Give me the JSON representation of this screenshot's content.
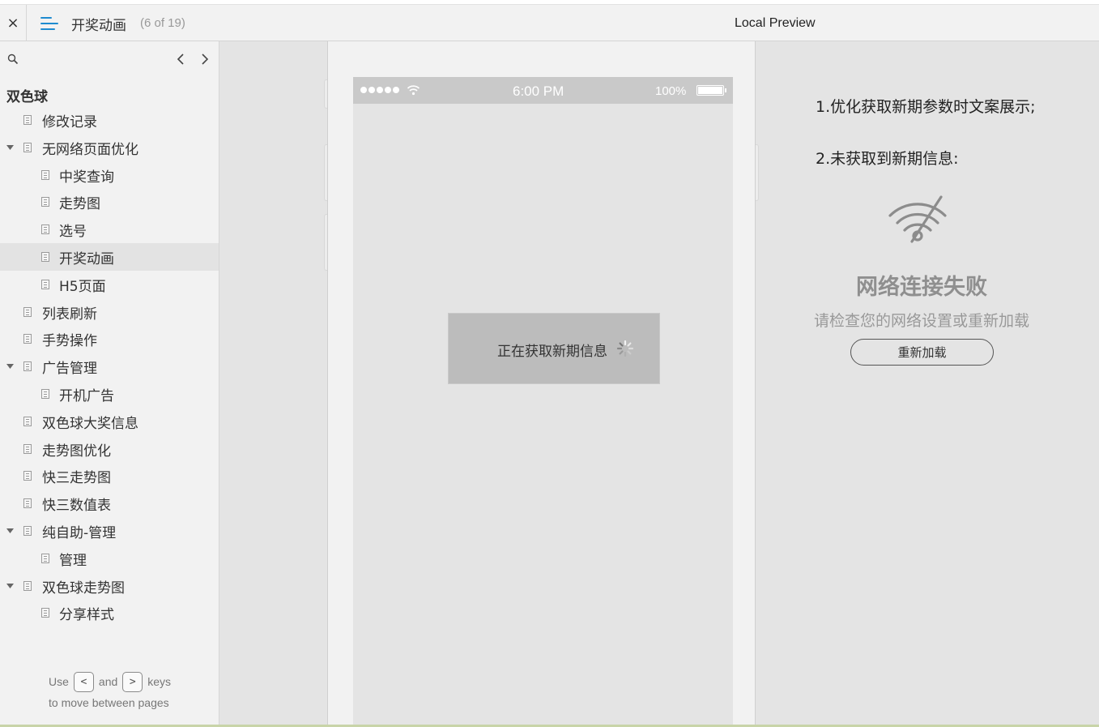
{
  "toolbar": {
    "close_glyph": "×",
    "page_title": "开奖动画",
    "page_count": "(6 of 19)",
    "preview_title": "Local Preview"
  },
  "sidebar": {
    "project_title": "双色球",
    "items": [
      {
        "label": "修改记录",
        "level": 1,
        "expandable": false,
        "selected": false
      },
      {
        "label": "无网络页面优化",
        "level": 1,
        "expandable": true,
        "selected": false
      },
      {
        "label": "中奖查询",
        "level": 2,
        "expandable": false,
        "selected": false
      },
      {
        "label": "走势图",
        "level": 2,
        "expandable": false,
        "selected": false
      },
      {
        "label": "选号",
        "level": 2,
        "expandable": false,
        "selected": false
      },
      {
        "label": "开奖动画",
        "level": 2,
        "expandable": false,
        "selected": true
      },
      {
        "label": "H5页面",
        "level": 2,
        "expandable": false,
        "selected": false
      },
      {
        "label": "列表刷新",
        "level": 1,
        "expandable": false,
        "selected": false
      },
      {
        "label": "手势操作",
        "level": 1,
        "expandable": false,
        "selected": false
      },
      {
        "label": "广告管理",
        "level": 1,
        "expandable": true,
        "selected": false
      },
      {
        "label": "开机广告",
        "level": 2,
        "expandable": false,
        "selected": false
      },
      {
        "label": "双色球大奖信息",
        "level": 1,
        "expandable": false,
        "selected": false
      },
      {
        "label": "走势图优化",
        "level": 1,
        "expandable": false,
        "selected": false
      },
      {
        "label": "快三走势图",
        "level": 1,
        "expandable": false,
        "selected": false
      },
      {
        "label": "快三数值表",
        "level": 1,
        "expandable": false,
        "selected": false
      },
      {
        "label": "纯自助-管理",
        "level": 1,
        "expandable": true,
        "selected": false
      },
      {
        "label": "管理",
        "level": 2,
        "expandable": false,
        "selected": false
      },
      {
        "label": "双色球走势图",
        "level": 1,
        "expandable": true,
        "selected": false
      },
      {
        "label": "分享样式",
        "level": 2,
        "expandable": false,
        "selected": false
      }
    ],
    "hint": {
      "use": "Use",
      "prev_key": "<\n,",
      "and": "and",
      "next_key": ">\n.",
      "keys": "keys",
      "line2": "to move between pages"
    }
  },
  "phone": {
    "time": "6:00 PM",
    "battery": "100%",
    "loading_text": "正在获取新期信息"
  },
  "notes": {
    "note1": "1.优化获取新期参数时文案展示;",
    "note2": "2.未获取到新期信息:",
    "fail_title": "网络连接失败",
    "fail_subtitle": "请检查您的网络设置或重新加载",
    "reload_label": "重新加载"
  },
  "colors": {
    "accent": "#1e8bd0",
    "selected_row": "#e3e3e3",
    "statusbar": "#c9c9c9",
    "loading_box": "#bcbcbc"
  }
}
